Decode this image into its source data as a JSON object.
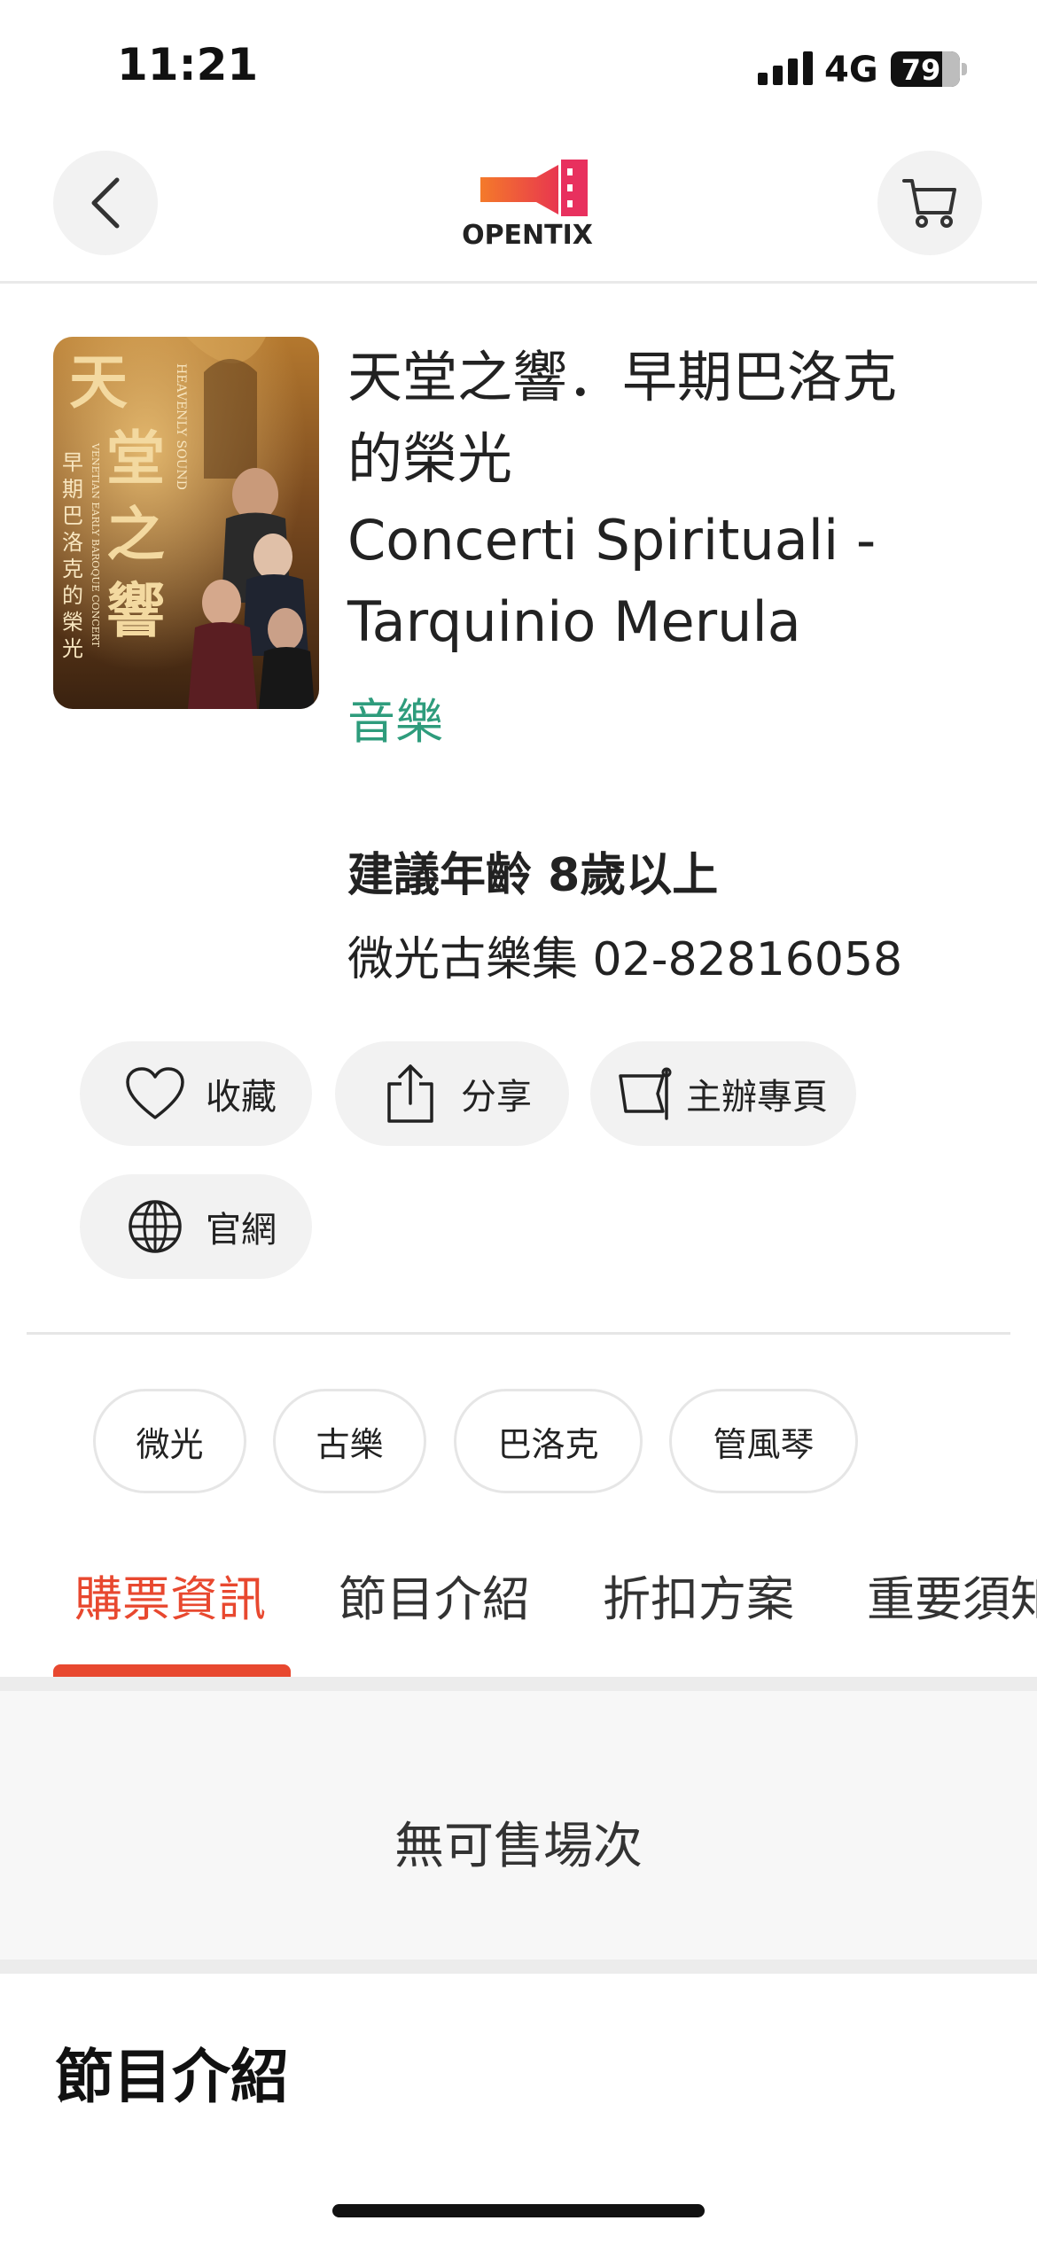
{
  "status_bar": {
    "time": "11:21",
    "network": "4G",
    "battery": "79"
  },
  "nav": {
    "back_icon": "chevron-left-icon",
    "logo_text": "OPENTIX",
    "cart_icon": "cart-icon"
  },
  "program": {
    "title_line1": "天堂之響．早期巴洛克",
    "title_line2": "的榮光",
    "title_line3": "Concerti Spirituali -",
    "title_line4": "Tarquinio Merula",
    "category": "音樂",
    "category_color": "#2e9c7c",
    "age": "建議年齡 8歲以上",
    "organizer": "微光古樂集 02-82816058",
    "poster": {
      "title_chars": "天堂之響",
      "subtitle_chars": "早期巴洛克的榮光",
      "english_1": "HEAVENLY SOUND",
      "english_2": "VENETIAN EARLY BAROQUE CONCERT"
    }
  },
  "actions": {
    "favorite": "收藏",
    "share": "分享",
    "organizer_page": "主辦專頁",
    "website": "官網"
  },
  "tags": [
    "微光",
    "古樂",
    "巴洛克",
    "管風琴"
  ],
  "tabs": {
    "items": [
      "購票資訊",
      "節目介紹",
      "折扣方案",
      "重要須知"
    ],
    "active_color": "#e8482f"
  },
  "ticket_panel": {
    "message": "無可售場次"
  },
  "section": {
    "title": "節目介紹"
  }
}
